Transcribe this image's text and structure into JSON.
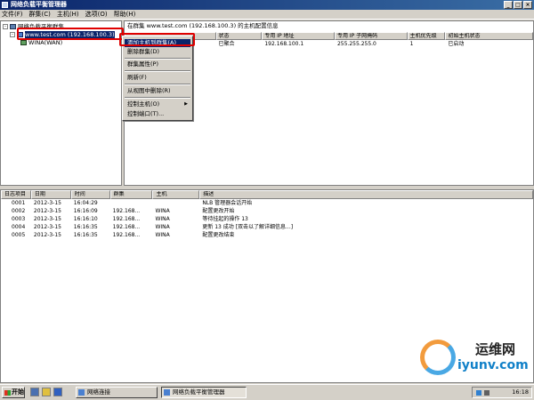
{
  "window": {
    "title": "网络负载平衡管理器"
  },
  "menubar": [
    "文件(F)",
    "群集(C)",
    "主机(H)",
    "选项(O)",
    "帮助(H)"
  ],
  "tree": {
    "root": "网络负载平衡群集",
    "cluster": "www.test.com (192.168.100.3)",
    "host": "WINA(WAN)"
  },
  "right_pane": {
    "caption": "在群集 www.test.com (192.168.100.3) 的主机配置信息",
    "columns": [
      "",
      "状态",
      "专用 IP 地址",
      "专用 IP 子网掩码",
      "主机优先级",
      "初始主机状态"
    ],
    "rows": [
      [
        "",
        "已聚合",
        "192.168.100.1",
        "255.255.255.0",
        "1",
        "已启动"
      ]
    ]
  },
  "context_menu": {
    "items": [
      "添加主机到群集(A)",
      "删除群集(D)",
      "群集属性(P)",
      "刷新(F)",
      "从视图中删除(R)",
      "控制主机(O)",
      "控制端口(T)..."
    ]
  },
  "log": {
    "columns": [
      "日志项目",
      "日期",
      "时间",
      "群集",
      "主机",
      "描述"
    ],
    "rows": [
      [
        "0001",
        "2012-3-15",
        "16:04:29",
        "",
        "",
        "NLB 管理器会话开始"
      ],
      [
        "0002",
        "2012-3-15",
        "16:16:09",
        "192.168...",
        "WINA",
        "配置更改开始"
      ],
      [
        "0003",
        "2012-3-15",
        "16:16:10",
        "192.168...",
        "WINA",
        "等待挂起的操作 13"
      ],
      [
        "0004",
        "2012-3-15",
        "16:16:35",
        "192.168...",
        "WINA",
        "更新 13 成功 [双击以了解详细信息...]"
      ],
      [
        "0005",
        "2012-3-15",
        "16:16:35",
        "192.168...",
        "WINA",
        "配置更改结束"
      ]
    ]
  },
  "watermark": {
    "title": "运维网",
    "url": "iyunv.com"
  },
  "taskbar": {
    "start": "开始",
    "buttons": [
      "网络连接",
      "网络负载平衡管理器"
    ],
    "clock": "16:18"
  }
}
